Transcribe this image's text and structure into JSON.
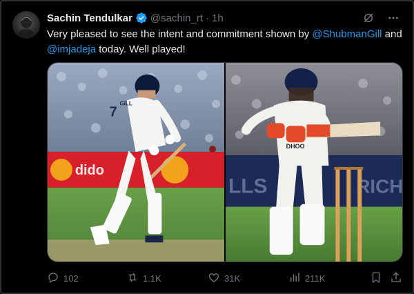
{
  "tweet": {
    "author_name": "Sachin Tendulkar",
    "handle": "@sachin_rt",
    "separator": "·",
    "time": "1h",
    "text_part1": "Very pleased to see the intent and commitment shown by ",
    "mention1": "@ShubmanGill",
    "text_part2": " and ",
    "mention2": "@imjadeja",
    "text_part3": " today. Well played!"
  },
  "media": {
    "left_photo": {
      "jersey_number": "7",
      "jersey_name": "GILL",
      "board_text": "dido"
    },
    "right_photo": {
      "jersey_name": "DHOO",
      "board_text": "LLS",
      "board_text_right": "RICH"
    }
  },
  "actions": {
    "replies": "102",
    "reposts": "1.1K",
    "likes": "31K",
    "views": "211K"
  },
  "colors": {
    "accent": "#1d9bf0",
    "muted": "#71767b",
    "text": "#e7e9ea",
    "background": "#000000"
  },
  "icons": [
    "verified-badge-icon",
    "grok-icon",
    "more-icon",
    "reply-icon",
    "repost-icon",
    "like-icon",
    "views-icon",
    "bookmark-icon",
    "share-icon"
  ]
}
